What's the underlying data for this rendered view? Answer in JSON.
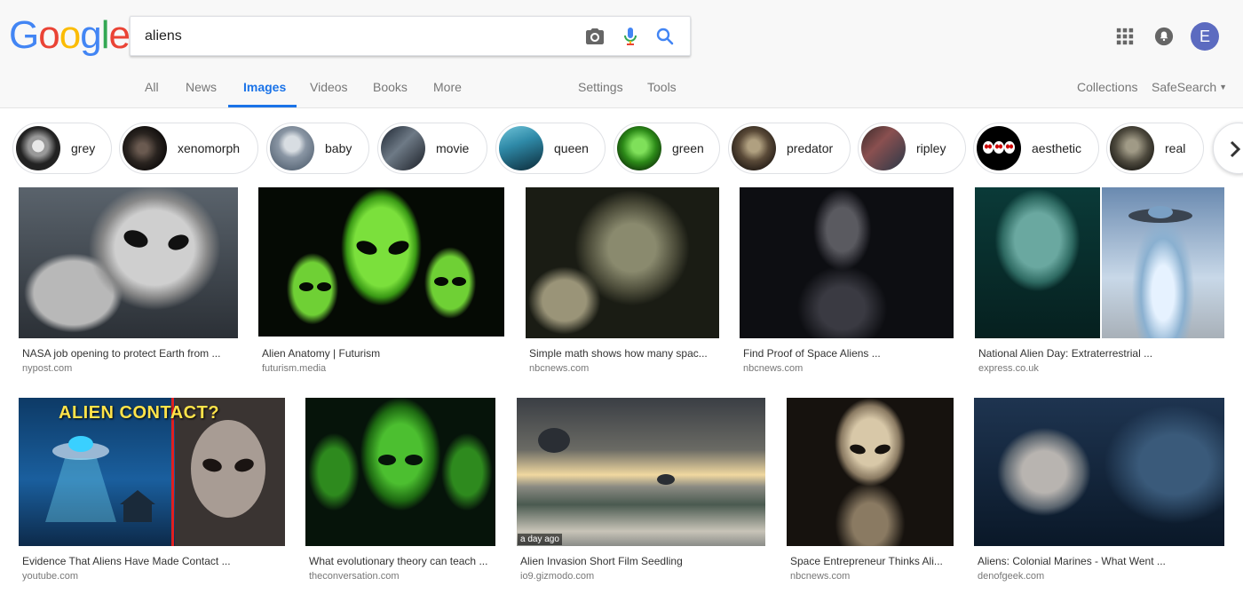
{
  "search": {
    "query": "aliens"
  },
  "logo": {
    "letters": [
      "G",
      "o",
      "o",
      "g",
      "l",
      "e"
    ],
    "colors": [
      "#4285f4",
      "#ea4335",
      "#fbbc05",
      "#4285f4",
      "#34a853",
      "#ea4335"
    ]
  },
  "account": {
    "initial": "E"
  },
  "icons": {
    "camera": "camera-icon",
    "mic": "microphone-icon",
    "search": "search-icon",
    "apps": "apps-grid-icon",
    "notifications": "notifications-icon",
    "next": "chevron-right-icon"
  },
  "tabs": {
    "all": "All",
    "news": "News",
    "images": "Images",
    "videos": "Videos",
    "books": "Books",
    "more": "More",
    "settings": "Settings",
    "tools": "Tools"
  },
  "right_links": {
    "collections": "Collections",
    "safesearch": "SafeSearch"
  },
  "chips": [
    {
      "label": "grey"
    },
    {
      "label": "xenomorph"
    },
    {
      "label": "baby"
    },
    {
      "label": "movie"
    },
    {
      "label": "queen"
    },
    {
      "label": "green"
    },
    {
      "label": "predator"
    },
    {
      "label": "ripley"
    },
    {
      "label": "aesthetic"
    },
    {
      "label": "real"
    }
  ],
  "results": [
    {
      "title": "NASA job opening to protect Earth from ...",
      "domain": "nypost.com"
    },
    {
      "title": "Alien Anatomy | Futurism",
      "domain": "futurism.media"
    },
    {
      "title": "Simple math shows how many spac...",
      "domain": "nbcnews.com"
    },
    {
      "title": "Find Proof of Space Aliens ...",
      "domain": "nbcnews.com"
    },
    {
      "title": "National Alien Day: Extraterrestrial ...",
      "domain": "express.co.uk"
    },
    {
      "title": "Evidence That Aliens Have Made Contact ...",
      "domain": "youtube.com",
      "overlay": "ALIEN CONTACT?"
    },
    {
      "title": "What evolutionary theory can teach ...",
      "domain": "theconversation.com"
    },
    {
      "title": "Alien Invasion Short Film Seedling",
      "domain": "io9.gizmodo.com",
      "badge": "a day ago"
    },
    {
      "title": "Space Entrepreneur Thinks Ali...",
      "domain": "nbcnews.com"
    },
    {
      "title": "Aliens: Colonial Marines - What Went ...",
      "domain": "denofgeek.com"
    }
  ],
  "colors": {
    "accent": "#1a73e8",
    "avatar": "#5c6bc0"
  }
}
